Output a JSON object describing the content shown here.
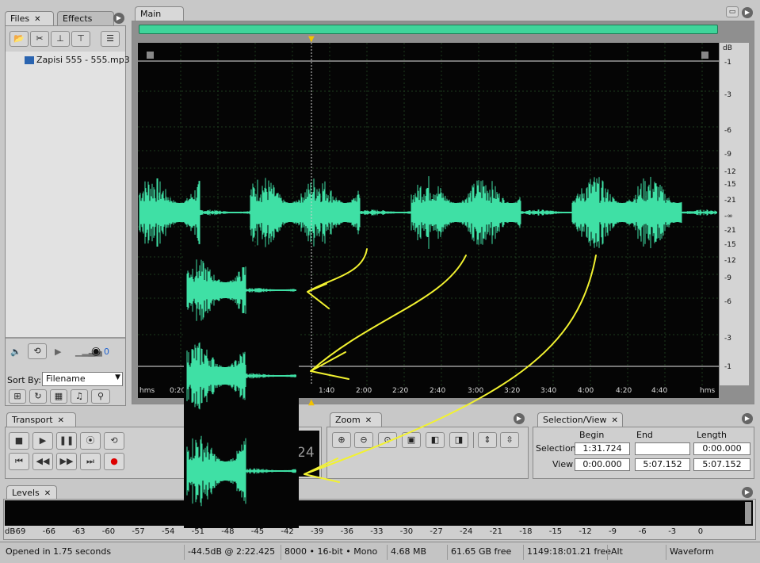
{
  "files_panel": {
    "tabs": [
      {
        "label": "Files"
      },
      {
        "label": "Effects"
      }
    ],
    "file_item": "Zapisi 555 - 555.mp3",
    "sort_label": "Sort By:",
    "sort_value": "Filename",
    "volume_value": "0"
  },
  "main_panel": {
    "tab_label": "Main",
    "db_unit": "dB",
    "db_labels": [
      "-1",
      "-3",
      "-6",
      "-9",
      "-12",
      "-15",
      "-21",
      "-∞",
      "-21",
      "-15",
      "-12",
      "-9",
      "-6",
      "-3",
      "-1"
    ],
    "ruler_start": "hms",
    "ruler_labels": [
      "0:20",
      "1:40",
      "2:00",
      "2:20",
      "2:40",
      "3:00",
      "3:20",
      "3:40",
      "4:00",
      "4:20",
      "4:40"
    ],
    "ruler_end": "hms"
  },
  "transport_panel": {
    "tab_label": "Transport",
    "time_fragment": "24"
  },
  "zoom_panel": {
    "tab_label": "Zoom"
  },
  "selection_panel": {
    "tab_label": "Selection/View",
    "headers": {
      "begin": "Begin",
      "end": "End",
      "length": "Length"
    },
    "selection_label": "Selection",
    "view_label": "View",
    "selection": {
      "begin": "1:31.724",
      "end": "",
      "length": "0:00.000"
    },
    "view": {
      "begin": "0:00.000",
      "end": "5:07.152",
      "length": "5:07.152"
    }
  },
  "levels_panel": {
    "tab_label": "Levels",
    "scale": [
      "dB",
      "-69",
      "-66",
      "-63",
      "-60",
      "-57",
      "-54",
      "-51",
      "-48",
      "-45",
      "-42",
      "-39",
      "-36",
      "-33",
      "-30",
      "-27",
      "-24",
      "-21",
      "-18",
      "-15",
      "-12",
      "-9",
      "-6",
      "-3",
      "0"
    ]
  },
  "status_bar": {
    "opened": "Opened in 1.75 seconds",
    "cursor": "-44.5dB @  2:22.425",
    "format": "8000 • 16-bit • Mono",
    "size": "4.68 MB",
    "free": "61.65 GB free",
    "time_free": "1149:18:01.21 free",
    "key": "Alt",
    "view_mode": "Waveform"
  },
  "colors": {
    "waveform": "#3fe0a5",
    "annotation": "#f2f230",
    "background": "#050505"
  }
}
